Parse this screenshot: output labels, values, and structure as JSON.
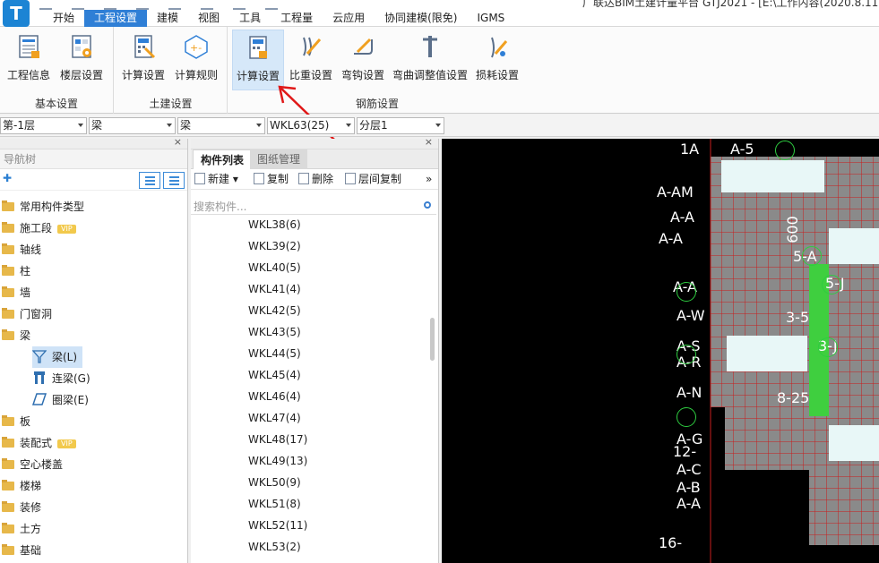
{
  "app": {
    "logo_letter": "T",
    "window_title": "广联达BIM土建计量平台 GTJ2021 - [E:\\工作内容(2020.8.11("
  },
  "menu": [
    "开始",
    "工程设置",
    "建模",
    "视图",
    "工具",
    "工程量",
    "云应用",
    "协同建模(限免)",
    "IGMS"
  ],
  "ribbon": {
    "groups": [
      {
        "label": "基本设置",
        "buttons": [
          "工程信息",
          "楼层设置"
        ]
      },
      {
        "label": "土建设置",
        "buttons": [
          "计算设置",
          "计算规则"
        ]
      },
      {
        "label": "钢筋设置",
        "buttons": [
          "计算设置",
          "比重设置",
          "弯钩设置",
          "弯曲调整值设置",
          "损耗设置"
        ]
      }
    ]
  },
  "selectors": [
    "第-1层",
    "梁",
    "梁",
    "WKL63(25)",
    "分层1"
  ],
  "nav": {
    "title": "导航树",
    "items": [
      "常用构件类型",
      "施工段",
      "轴线",
      "柱",
      "墙",
      "门窗洞",
      "梁",
      "板",
      "装配式",
      "空心楼盖",
      "楼梯",
      "装修",
      "土方",
      "基础"
    ],
    "vip_label": "VIP",
    "beam_children": [
      "梁(L)",
      "连梁(G)",
      "圈梁(E)"
    ]
  },
  "list": {
    "tabs": [
      "构件列表",
      "图纸管理"
    ],
    "tools": [
      "新建",
      "复制",
      "删除",
      "层间复制"
    ],
    "search_placeholder": "搜索构件...",
    "rows": [
      "WKL38(6)",
      "WKL39(2)",
      "WKL40(5)",
      "WKL41(4)",
      "WKL42(5)",
      "WKL43(5)",
      "WKL44(5)",
      "WKL45(4)",
      "WKL46(4)",
      "WKL47(4)",
      "WKL48(17)",
      "WKL49(13)",
      "WKL50(9)",
      "WKL51(8)",
      "WKL52(11)",
      "WKL53(2)"
    ]
  },
  "canvas": {
    "labels": [
      "A-AM",
      "A-A",
      "A-A",
      "A-A",
      "A-W",
      "A-S",
      "A-R",
      "A-N",
      "A-G",
      "A-C",
      "A-B",
      "A-A",
      "1A",
      "12-",
      "16-",
      "600",
      "5-A",
      "5-J",
      "3-5",
      "3-J",
      "8-25",
      "A-5"
    ]
  },
  "colors": {
    "accent": "#2f7fd6",
    "grid": "#c81e1e",
    "wall": "#8a8a8a",
    "slab": "#3fcf3f"
  }
}
